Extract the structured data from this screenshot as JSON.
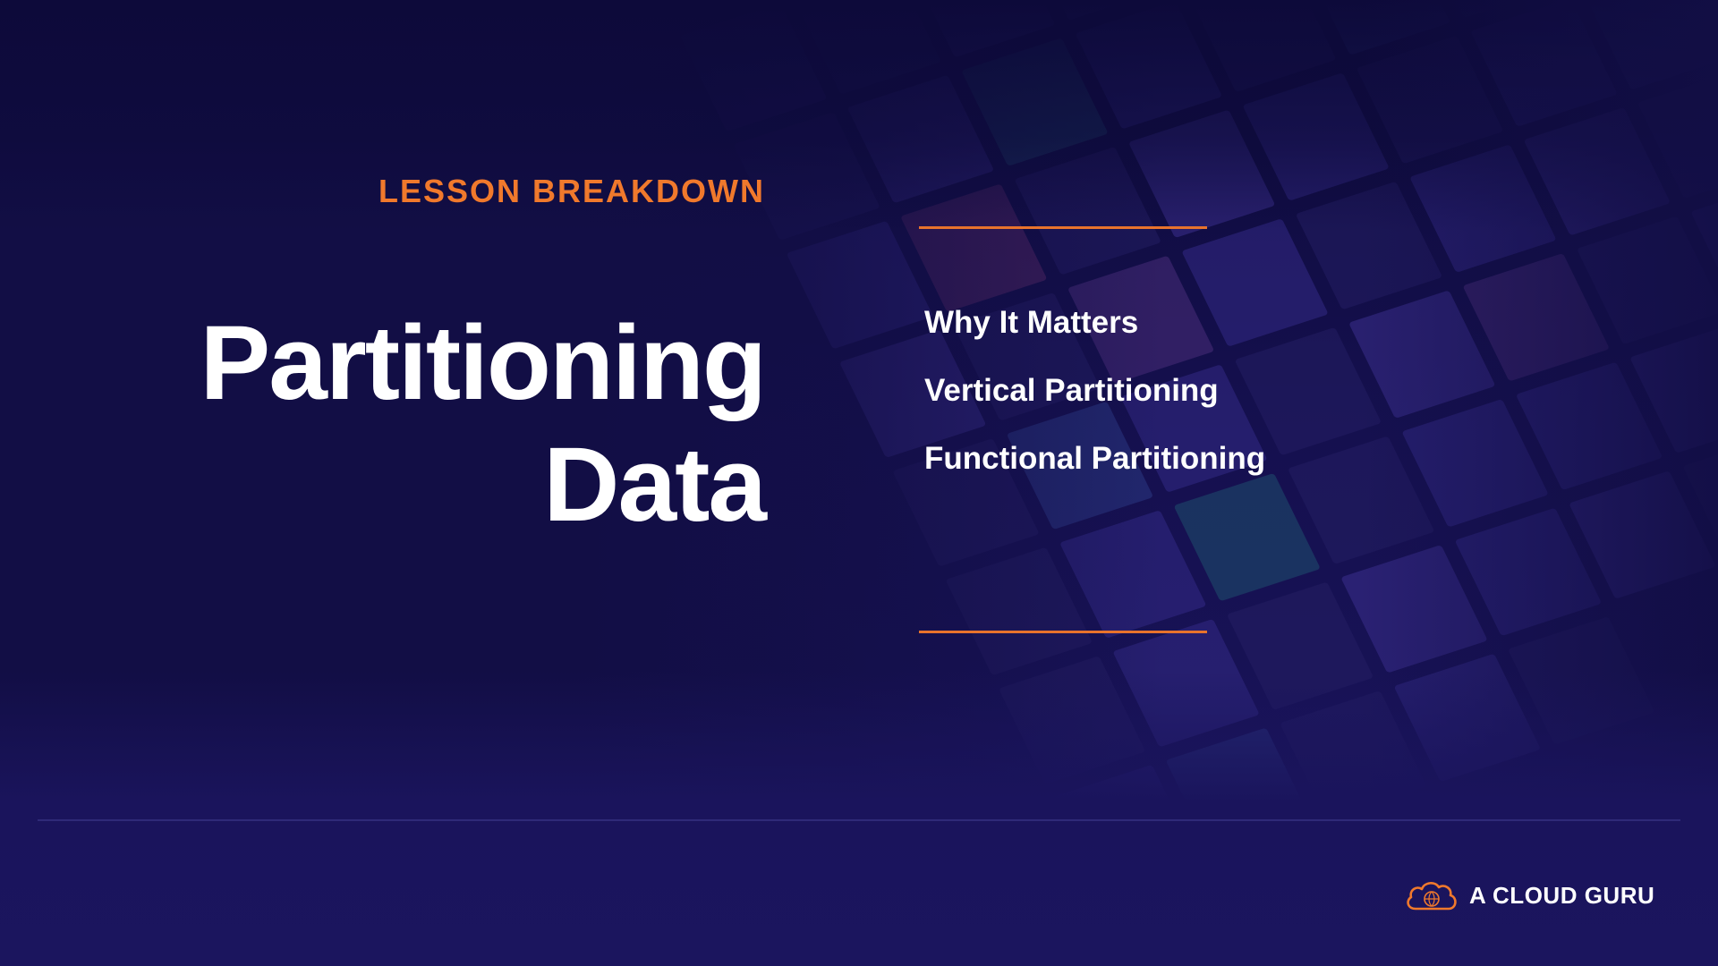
{
  "slide": {
    "eyebrow": "LESSON BREAKDOWN",
    "title_lines": [
      "Partitioning",
      "Data"
    ],
    "topics": [
      "Why It Matters",
      "Vertical Partitioning",
      "Functional Partitioning"
    ]
  },
  "brand": {
    "name": "A CLOUD GURU",
    "logo_icon": "cloud-logo-icon"
  },
  "colors": {
    "background": "#14104a",
    "accent": "#f0792c",
    "text": "#ffffff"
  }
}
